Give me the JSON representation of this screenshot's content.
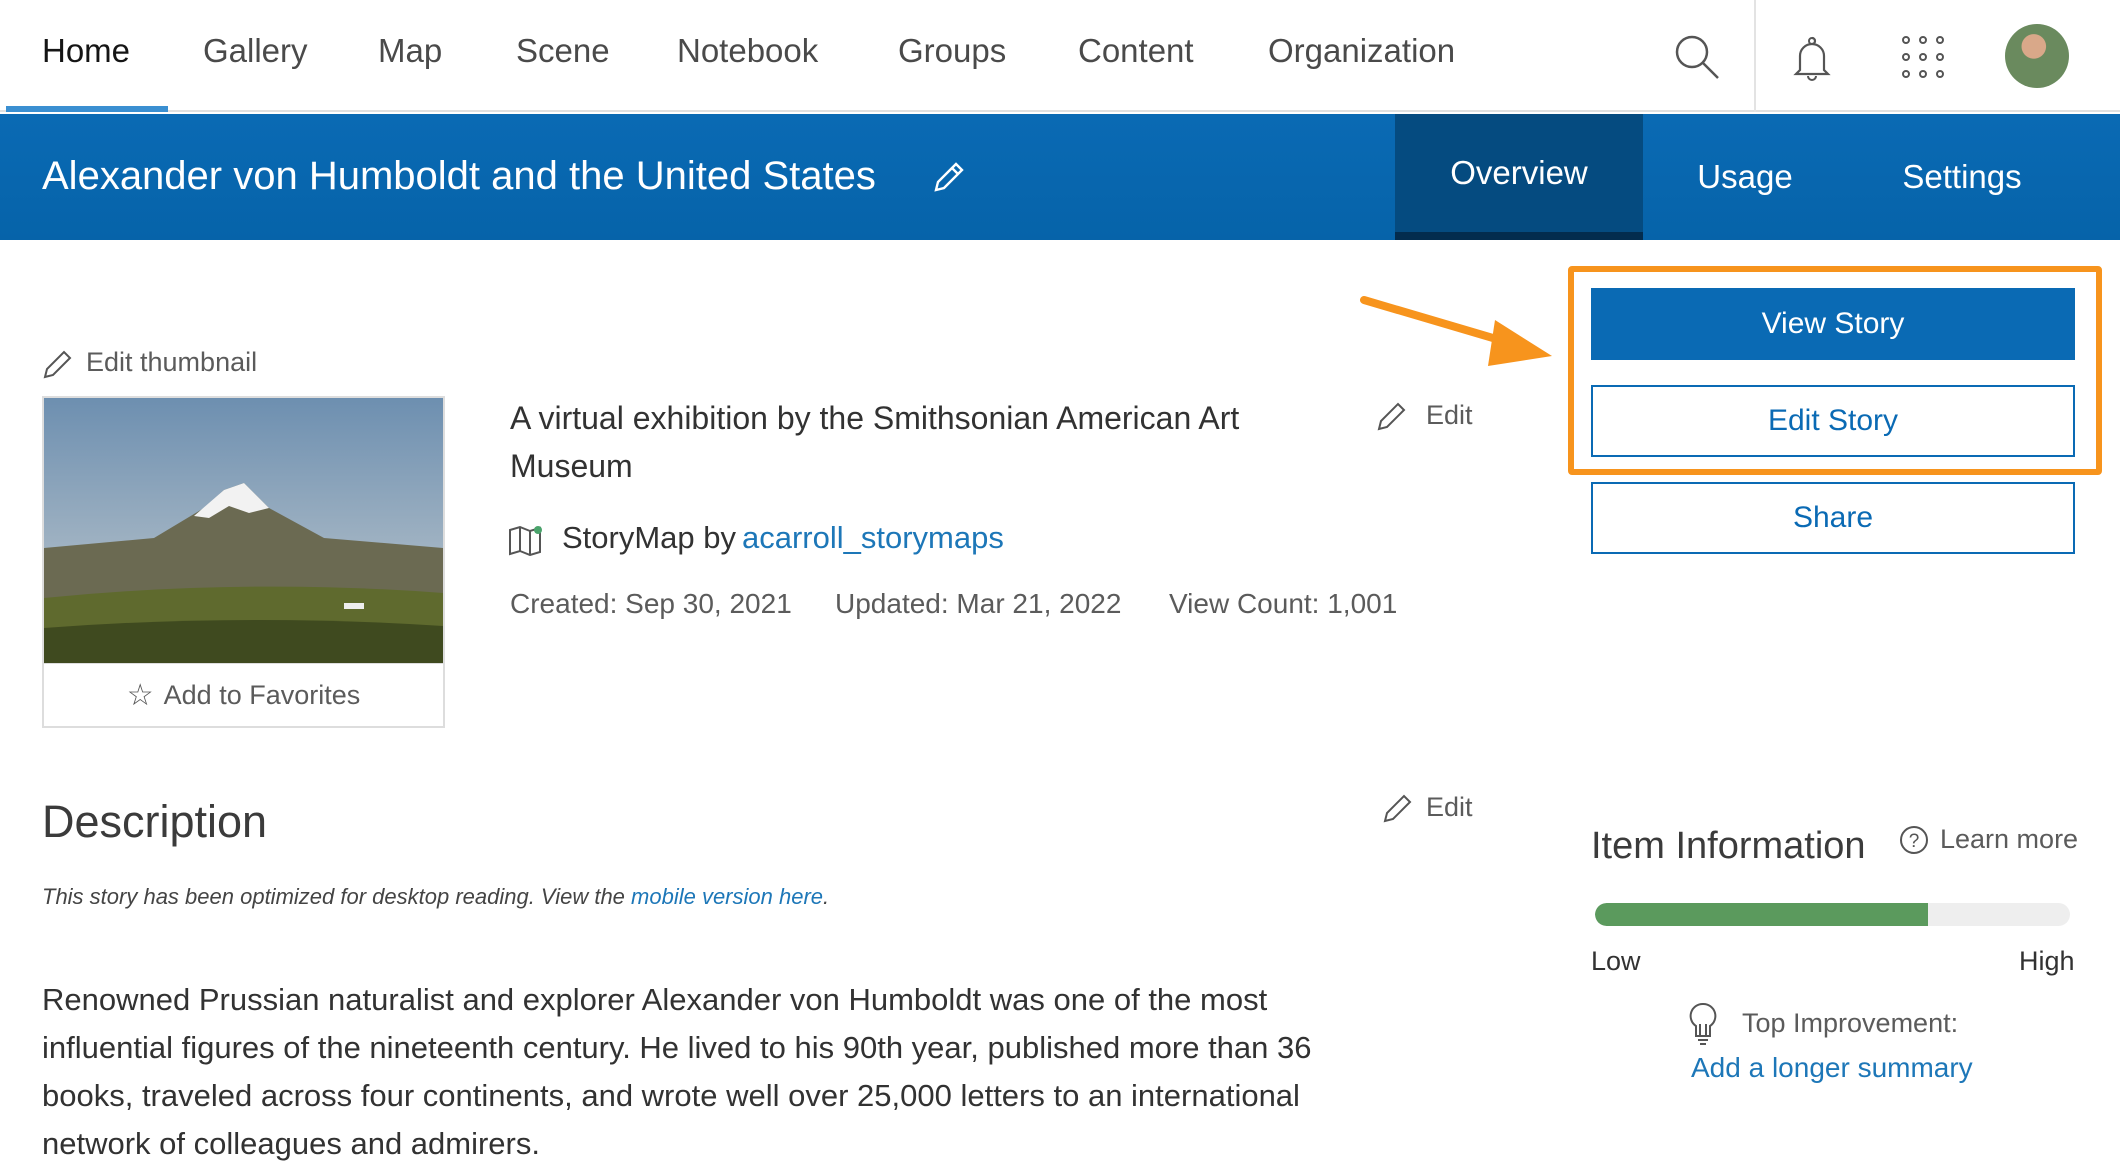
{
  "nav": {
    "items": [
      "Home",
      "Gallery",
      "Map",
      "Scene",
      "Notebook",
      "Groups",
      "Content",
      "Organization"
    ],
    "active": "Home"
  },
  "banner": {
    "title": "Alexander von Humboldt and the United States",
    "tabs": [
      "Overview",
      "Usage",
      "Settings"
    ],
    "active_tab": "Overview"
  },
  "thumbnail": {
    "edit_label": "Edit thumbnail",
    "favorites_label": "Add to Favorites"
  },
  "summary": {
    "text_line1": "A virtual exhibition by the Smithsonian American Art",
    "text_line2": "Museum",
    "edit_label": "Edit",
    "type_label": "StoryMap by",
    "owner": "acarroll_storymaps",
    "created": "Created: Sep 30, 2021",
    "updated": "Updated: Mar 21, 2022",
    "views": "View Count: 1,001"
  },
  "actions": {
    "view": "View Story",
    "edit": "Edit Story",
    "share": "Share"
  },
  "description": {
    "heading": "Description",
    "edit_label": "Edit",
    "note_prefix": "This story has been optimized for desktop reading. View the ",
    "note_link": "mobile version here",
    "note_suffix": ".",
    "lines": [
      "Renowned Prussian naturalist and explorer Alexander von Humboldt was one of the most",
      "influential figures of the nineteenth century. He lived to his 90th year, published more than 36",
      "books, traveled across four continents, and wrote well over 25,000 letters to an international",
      "network of colleagues and admirers."
    ]
  },
  "item_info": {
    "heading": "Item Information",
    "learn_more": "Learn more",
    "score_percent": 70,
    "low": "Low",
    "high": "High",
    "improvement_label": "Top Improvement:",
    "improvement_link": "Add a longer summary"
  },
  "colors": {
    "brand": "#0a6ab4",
    "highlight": "#f7941d",
    "progress": "#5b9a5d"
  }
}
